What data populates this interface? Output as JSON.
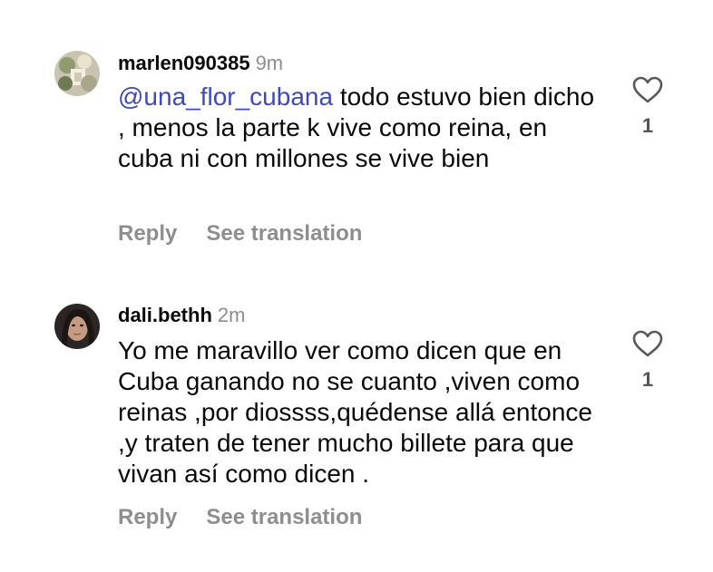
{
  "comments": [
    {
      "username": "marlen090385",
      "time": "9m",
      "mention": "@una_flor_cubana",
      "text": " todo estuvo bien dicho , menos la parte k vive como reina, en cuba ni con millones se vive bien",
      "reply_label": "Reply",
      "translate_label": "See translation",
      "like_count": "1",
      "avatar_icon": "avatar-image"
    },
    {
      "username": "dali.bethh",
      "time": "2m",
      "mention": "",
      "text": "Yo me maravillo ver como dicen que en Cuba ganando no se cuanto ,viven como reinas ,por diossss,quédense allá entonce ,y traten de tener mucho billete para que vivan así como dicen .",
      "reply_label": "Reply",
      "translate_label": "See translation",
      "like_count": "1",
      "avatar_icon": "avatar-image"
    }
  ],
  "colors": {
    "mention": "#3d4ab8",
    "muted": "#8e8e8e",
    "text": "#0a0a0a"
  },
  "icons": {
    "like": "heart-outline-icon"
  }
}
